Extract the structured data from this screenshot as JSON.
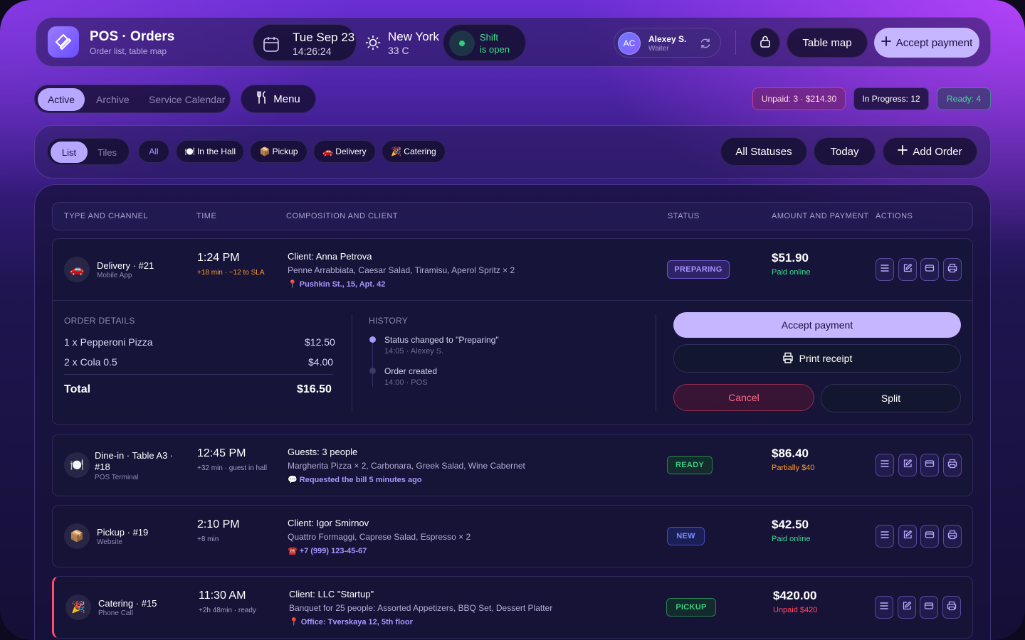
{
  "app": {
    "title": "POS · Orders",
    "subtitle": "Order list, table map",
    "brand_color": "#8b6cff"
  },
  "header": {
    "date": "Tue Sep 23",
    "time": "14:26:24",
    "weather": {
      "city": "New York",
      "temp": "33 C",
      "icon": "sun-icon"
    },
    "shift": {
      "line1": "Shift",
      "line2": "is open",
      "color": "#3ee08a"
    },
    "user": {
      "initials": "AC",
      "name": "Alexey S.",
      "role": "Waiter"
    },
    "table_map_label": "Table map",
    "accept_payment_label": "Accept payment"
  },
  "tabs": {
    "active": "Active",
    "archive": "Archive",
    "calendar": "Service Calendar"
  },
  "menu_label": "Menu",
  "stats": {
    "unpaid": "Unpaid: 3 · $214.30",
    "in_progress": "In Progress: 12",
    "ready": "Ready: 4"
  },
  "filters": {
    "view_list": "List",
    "view_tiles": "Tiles",
    "all": "All",
    "hall": "In the Hall",
    "pickup": "Pickup",
    "delivery": "Delivery",
    "catering": "Catering",
    "statuses": "All Statuses",
    "today": "Today",
    "add_order": "Add Order"
  },
  "table_headers": {
    "type": "TYPE AND CHANNEL",
    "time": "TIME",
    "composition": "COMPOSITION AND CLIENT",
    "status": "STATUS",
    "amount": "AMOUNT AND PAYMENT",
    "actions": "ACTIONS"
  },
  "orders": [
    {
      "icon": "🚗",
      "channel": "Delivery · #21",
      "source": "Mobile App",
      "time": "1:24 PM",
      "sla": "+18 min · −12 to SLA",
      "client": "Client: Anna Petrova",
      "items": "Penne Arrabbiata, Caesar Salad, Tiramisu, Aperol Spritz × 2",
      "note": "📍 Pushkin St., 15, Apt. 42",
      "status": "PREPARING",
      "amount": "$51.90",
      "payment": "Paid online",
      "payment_color": "#3edc94"
    },
    {
      "icon": "🍽️",
      "channel": "Dine-in · Table A3 · #18",
      "source": "POS Terminal",
      "time": "12:45 PM",
      "sla": "+32 min · guest in hall",
      "client": "Guests: 3 people",
      "items": "Margherita Pizza × 2, Carbonara, Greek Salad, Wine Cabernet",
      "note": "💬 Requested the bill 5 minutes ago",
      "status": "READY",
      "amount": "$86.40",
      "payment": "Partially $40",
      "payment_color": "#ff9b2e"
    },
    {
      "icon": "📦",
      "channel": "Pickup · #19",
      "source": "Website",
      "time": "2:10 PM",
      "sla": "+8 min",
      "client": "Client: Igor Smirnov",
      "items": "Quattro Formaggi, Caprese Salad, Espresso × 2",
      "note": "☎️ +7 (999) 123-45-67",
      "status": "NEW",
      "amount": "$42.50",
      "payment": "Paid online",
      "payment_color": "#3edc94"
    },
    {
      "icon": "🎉",
      "channel": "Catering · #15",
      "source": "Phone Call",
      "time": "11:30 AM",
      "sla": "+2h 48min · ready",
      "client": "Client: LLC \"Startup\"",
      "items": "Banquet for 25 people: Assorted Appetizers, BBQ Set, Dessert Platter",
      "note": "📍 Office: Tverskaya 12, 5th floor",
      "status": "PICKUP",
      "amount": "$420.00",
      "payment": "Unpaid $420",
      "payment_color": "#ff4d6a"
    }
  ],
  "details": {
    "label": "ORDER DETAILS",
    "lines": [
      {
        "name": "1 x Pepperoni Pizza",
        "price": "$12.50"
      },
      {
        "name": "2 x Cola 0.5",
        "price": "$4.00"
      }
    ],
    "total_label": "Total",
    "total": "$16.50"
  },
  "history": {
    "label": "HISTORY",
    "events": [
      {
        "title": "Status changed to \"Preparing\"",
        "sub": "14:05 · Alexey S."
      },
      {
        "title": "Order created",
        "sub": "14:00 · POS"
      }
    ]
  },
  "expanded_actions": {
    "accept": "Accept payment",
    "print": "Print receipt",
    "cancel": "Cancel",
    "split": "Split"
  }
}
